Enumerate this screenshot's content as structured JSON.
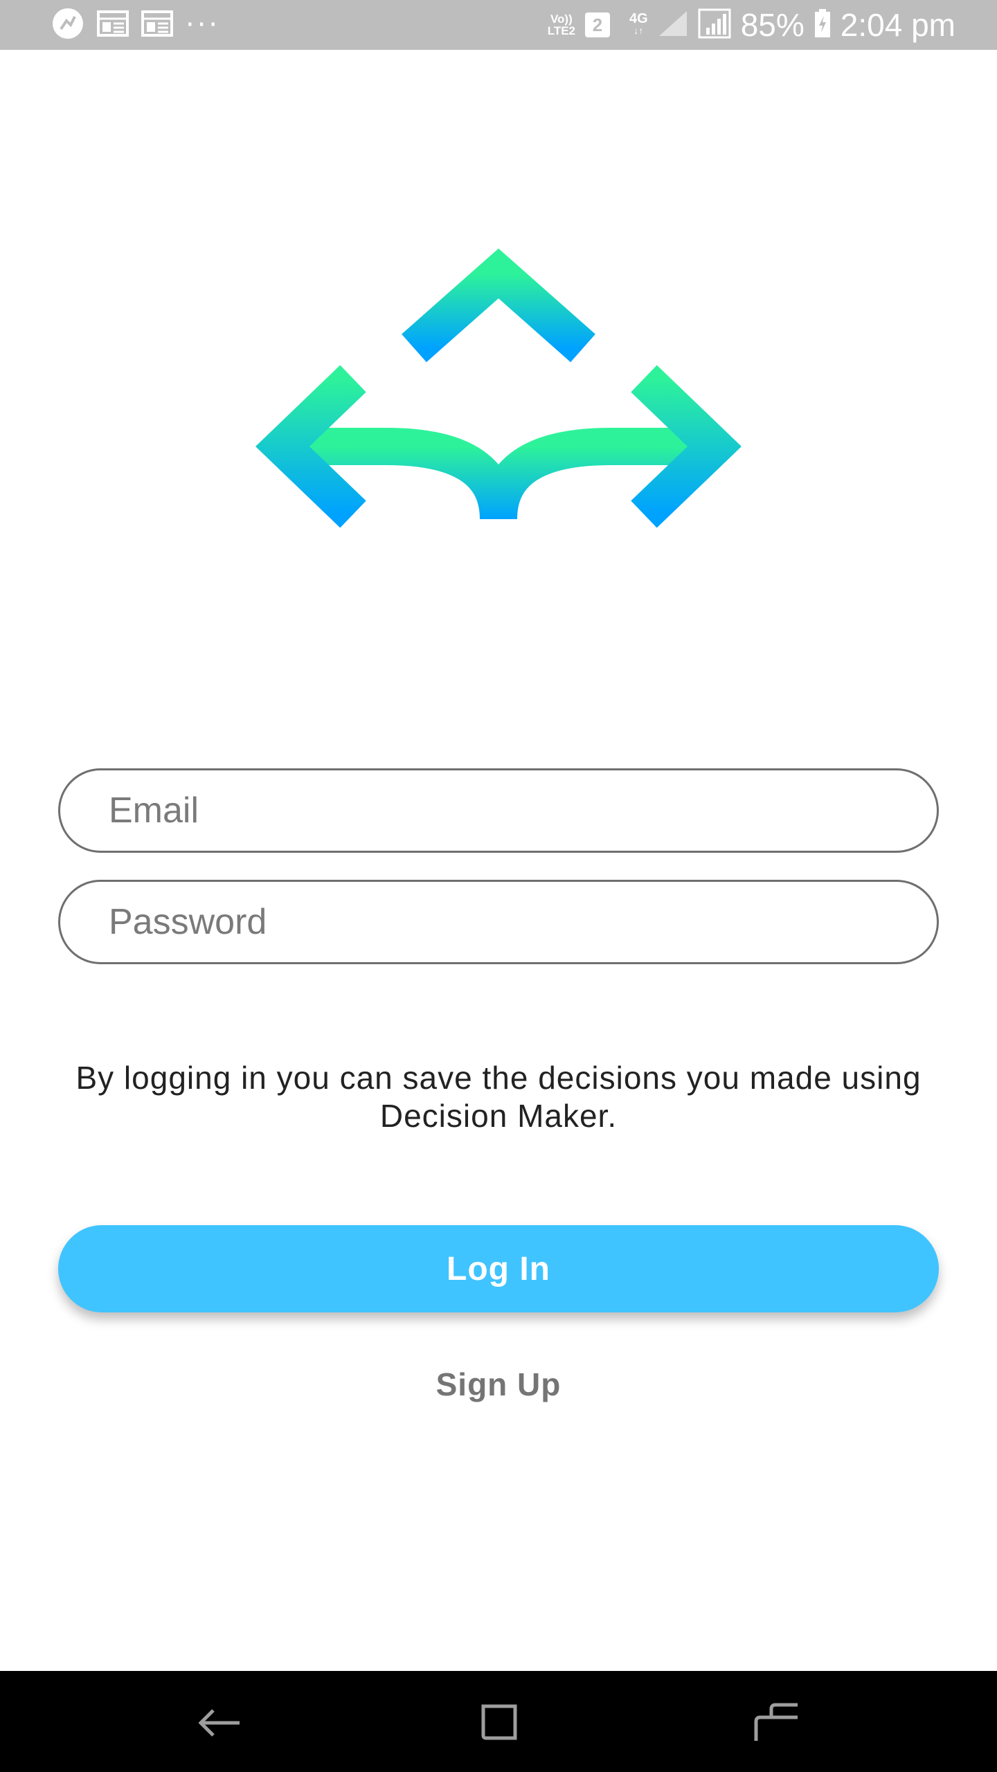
{
  "status_bar": {
    "network_label_top": "Vo))",
    "network_label_bottom": "LTE2",
    "sim_badge": "2",
    "network_type": "4G",
    "battery_percent": "85%",
    "time": "2:04 pm",
    "left_icons": [
      "app-notification-icon",
      "news-icon",
      "news-icon",
      "more-dots-icon"
    ],
    "more_dots": "···",
    "background_color": "#bdbdbd"
  },
  "logo": {
    "icon": "three-way-arrow-icon",
    "gradient_top": "#2ef29a",
    "gradient_bottom": "#00a2ff"
  },
  "form": {
    "email_placeholder": "Email",
    "email_value": "",
    "password_placeholder": "Password",
    "password_value": ""
  },
  "info_text": "By logging in you can save the decisions you made using Decision Maker.",
  "login_button": {
    "label": "Log In",
    "color": "#40c4ff"
  },
  "signup_link": {
    "label": "Sign Up"
  },
  "nav_bar": {
    "buttons": [
      "back-icon",
      "home-square-icon",
      "recent-apps-icon"
    ]
  }
}
